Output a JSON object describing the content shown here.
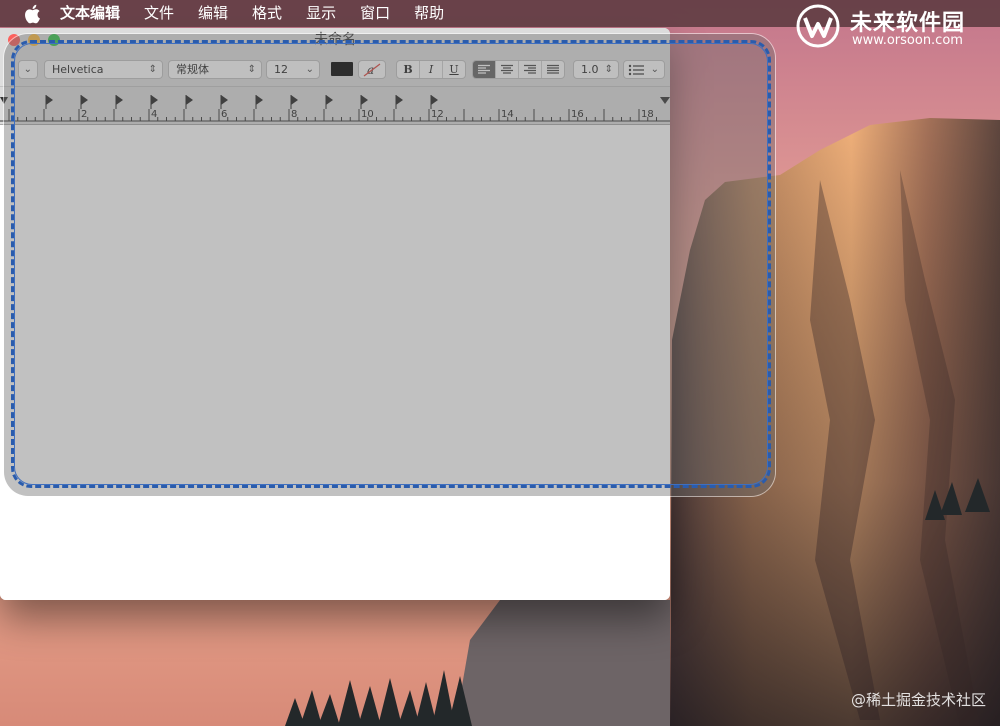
{
  "menubar": {
    "items": [
      "文本编辑",
      "文件",
      "编辑",
      "格式",
      "显示",
      "窗口",
      "帮助"
    ]
  },
  "brand": {
    "name": "未来软件园",
    "url": "www.orsoon.com"
  },
  "window": {
    "title": "未命名",
    "toolbar": {
      "font_family": "Helvetica",
      "font_style": "常规体",
      "font_size": "12",
      "text_color": "#000000",
      "bold": "B",
      "italic": "I",
      "underline": "U",
      "line_spacing": "1.0"
    },
    "ruler_labels": [
      "2",
      "4",
      "6",
      "8",
      "10",
      "12",
      "14",
      "16",
      "18"
    ]
  },
  "watermark": "@稀土掘金技术社区",
  "colors": {
    "selection_border": "#2a5cad",
    "menubar": "#5c3a40"
  }
}
